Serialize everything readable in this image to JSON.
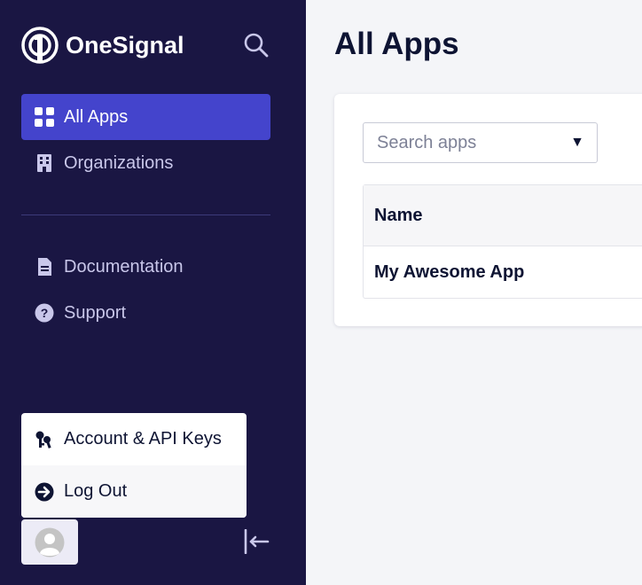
{
  "brand": {
    "name": "OneSignal"
  },
  "sidebar": {
    "nav": [
      {
        "label": "All Apps",
        "icon": "grid-icon",
        "active": true
      },
      {
        "label": "Organizations",
        "icon": "building-icon",
        "active": false
      }
    ],
    "secondary": [
      {
        "label": "Documentation",
        "icon": "document-icon"
      },
      {
        "label": "Support",
        "icon": "question-icon"
      }
    ]
  },
  "user_menu": {
    "items": [
      {
        "label": "Account & API Keys",
        "icon": "keys-icon"
      },
      {
        "label": "Log Out",
        "icon": "logout-icon"
      }
    ]
  },
  "main": {
    "title": "All Apps",
    "search": {
      "placeholder": "Search apps",
      "value": ""
    },
    "table": {
      "columns": [
        "Name"
      ],
      "rows": [
        {
          "name": "My Awesome App"
        }
      ]
    }
  },
  "colors": {
    "sidebar_bg": "#1a1643",
    "active_bg": "#4444cc",
    "page_bg": "#f4f5f8"
  }
}
